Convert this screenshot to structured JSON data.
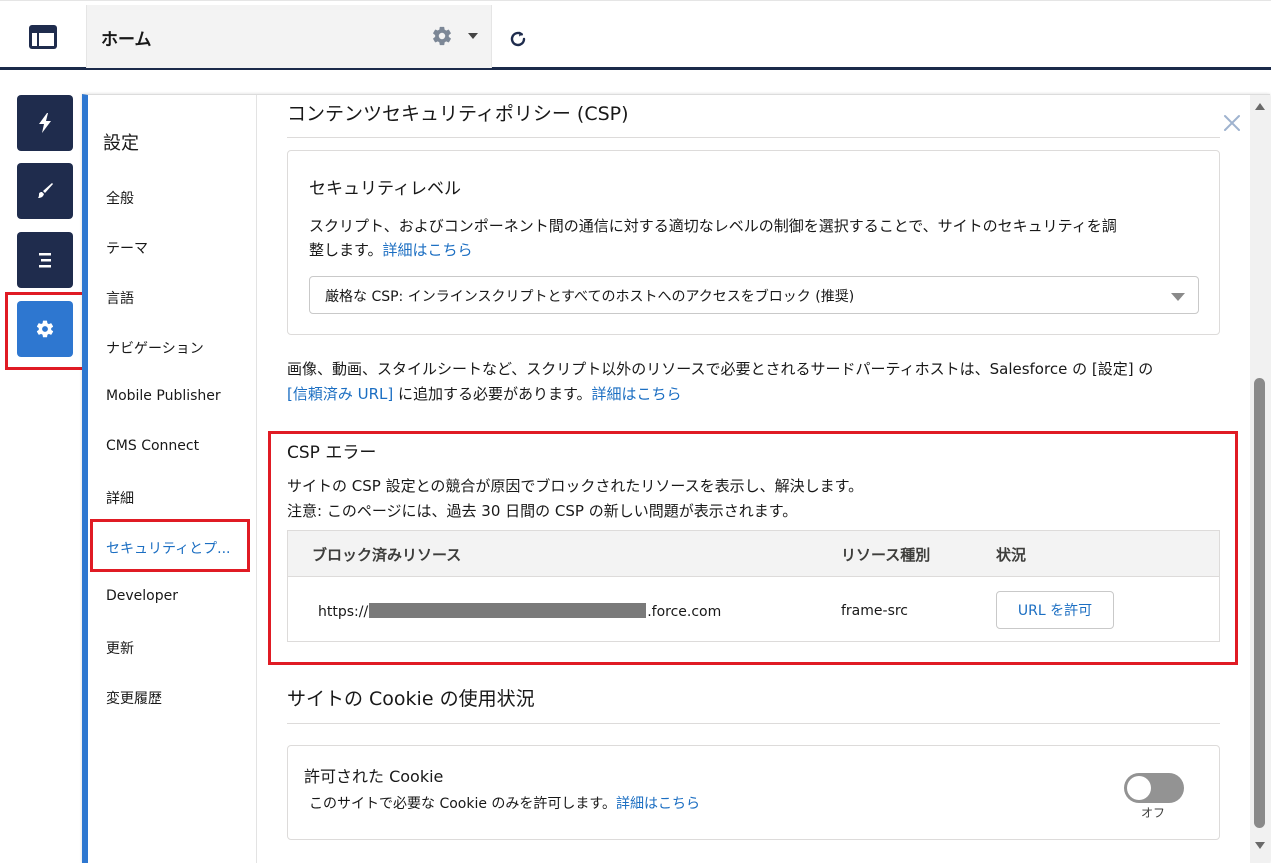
{
  "topbar": {
    "home_label": "ホーム"
  },
  "rail": {
    "items": [
      {
        "icon": "bolt-icon"
      },
      {
        "icon": "brush-icon"
      },
      {
        "icon": "list-icon"
      },
      {
        "icon": "gear-icon",
        "active": true
      }
    ]
  },
  "nav": {
    "title": "設定",
    "items": [
      {
        "label": "全般"
      },
      {
        "label": "テーマ"
      },
      {
        "label": "言語"
      },
      {
        "label": "ナビゲーション"
      },
      {
        "label": "Mobile Publisher"
      },
      {
        "label": "CMS Connect"
      },
      {
        "label": "詳細"
      },
      {
        "label": "セキュリティとプ..."
      },
      {
        "label": "Developer"
      },
      {
        "label": "更新"
      },
      {
        "label": "変更履歴"
      }
    ],
    "active_index": 7
  },
  "csp": {
    "heading": "コンテンツセキュリティポリシー (CSP)",
    "security_level": {
      "title": "セキュリティレベル",
      "desc_line1": "スクリプト、およびコンポーネント間の通信に対する適切なレベルの制御を選択することで、サイトのセキュリティを調",
      "desc_line2": "整します。",
      "learn_more": "詳細はこちら",
      "selected": "厳格な CSP: インラインスクリプトとすべてのホストへのアクセスをブロック (推奨)"
    },
    "note_line1": "画像、動画、スタイルシートなど、スクリプト以外のリソースで必要とされるサードパーティホストは、Salesforce の [設定] の",
    "trusted_url_link": "[信頼済み URL]",
    "note_line2_after": " に追加する必要があります。",
    "note_learn_more": "詳細はこちら"
  },
  "csp_errors": {
    "title": "CSP エラー",
    "desc_line1": "サイトの CSP 設定との競合が原因でブロックされたリソースを表示し、解決します。",
    "desc_line2": "注意: このページには、過去 30 日間の CSP の新しい問題が表示されます。",
    "columns": [
      "ブロック済みリソース",
      "リソース種別",
      "状況"
    ],
    "rows": [
      {
        "resource_prefix": "https://",
        "resource_suffix": ".force.com",
        "type": "frame-src",
        "action": "URL を許可"
      }
    ]
  },
  "cookie": {
    "heading": "サイトの Cookie の使用状況",
    "allowed_title": "許可された Cookie",
    "allowed_desc": "このサイトで必要な Cookie のみを許可します。",
    "learn_more": "詳細はこちら",
    "toggle_label": "オフ",
    "toggle_on": false
  },
  "colors": {
    "accent": "#2e77d0",
    "rail": "#1f2c4d",
    "highlight": "#e01b24",
    "link": "#1b6ec2"
  }
}
